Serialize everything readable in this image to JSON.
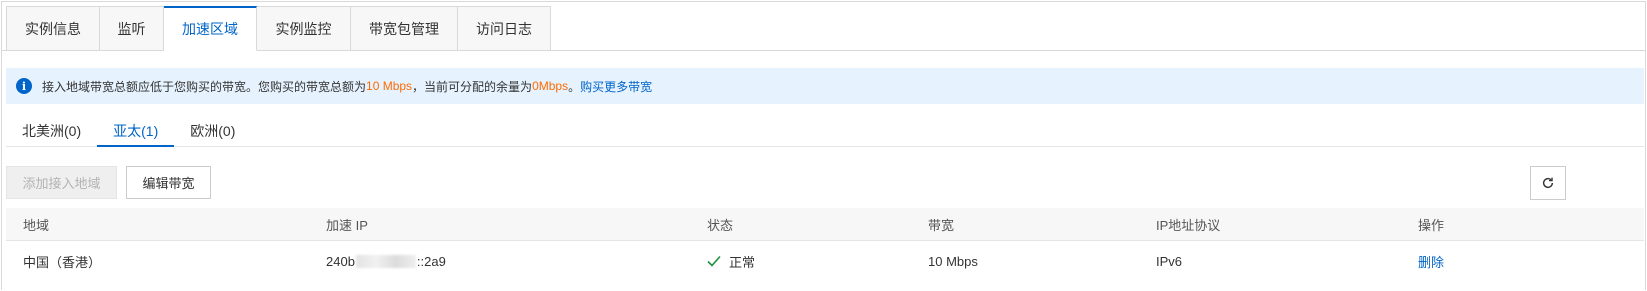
{
  "main_tabs": [
    {
      "label": "实例信息",
      "active": false
    },
    {
      "label": "监听",
      "active": false
    },
    {
      "label": "加速区域",
      "active": true
    },
    {
      "label": "实例监控",
      "active": false
    },
    {
      "label": "带宽包管理",
      "active": false
    },
    {
      "label": "访问日志",
      "active": false
    }
  ],
  "notice": {
    "text_1": "接入地域带宽总额应低于您购买的带宽。您购买的带宽总额为",
    "total_bandwidth": "10 Mbps",
    "text_2": "，当前可分配的余量为",
    "remaining": "0Mbps",
    "text_3": "。",
    "link": "购买更多带宽",
    "icon": "info-icon"
  },
  "region_tabs": [
    {
      "label": "北美洲(0)",
      "active": false
    },
    {
      "label": "亚太(1)",
      "active": true
    },
    {
      "label": "欧洲(0)",
      "active": false
    }
  ],
  "toolbar": {
    "add_label": "添加接入地域",
    "edit_label": "编辑带宽",
    "refresh_icon": "refresh-icon"
  },
  "table": {
    "headers": [
      "地域",
      "加速 IP",
      "状态",
      "带宽",
      "IP地址协议",
      "操作"
    ],
    "rows": [
      {
        "region": "中国（香港）",
        "ip_prefix": "240b",
        "ip_suffix": "::2a9",
        "status": "正常",
        "bandwidth": "10 Mbps",
        "protocol": "IPv6",
        "action": "删除"
      }
    ]
  },
  "colors": {
    "accent": "#0064c8",
    "highlight": "#ff6a00",
    "notice_bg": "#e6f3ff",
    "success": "#1e8e3e"
  }
}
